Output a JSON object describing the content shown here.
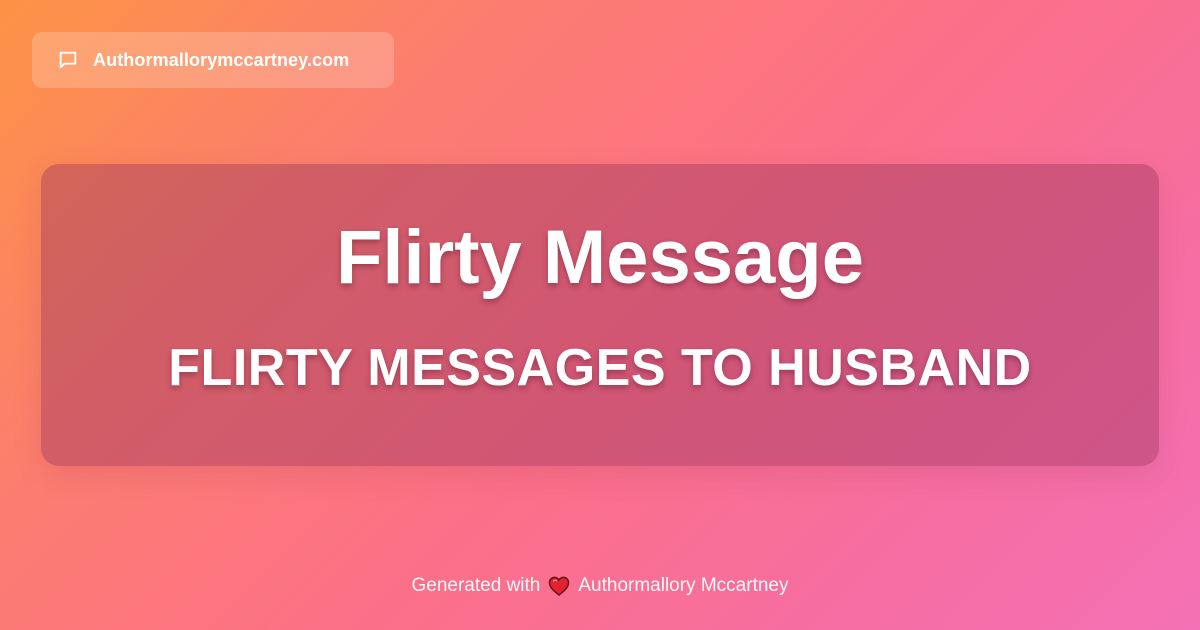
{
  "header": {
    "site_domain": "Authormallorymccartney.com",
    "icon": "message-square-icon"
  },
  "hero": {
    "title": "Flirty Message",
    "subtitle": "FLIRTY MESSAGES TO HUSBAND"
  },
  "footer": {
    "generated_prefix": "Generated with",
    "heart_icon": "heart-icon",
    "author": "Authormallory Mccartney"
  },
  "colors": {
    "gradient_start": "#fd9345",
    "gradient_mid": "#fb7089",
    "gradient_end": "#f370b4",
    "card_overlay": "#963259",
    "text": "#ffffff",
    "heart": "#e0242f"
  }
}
